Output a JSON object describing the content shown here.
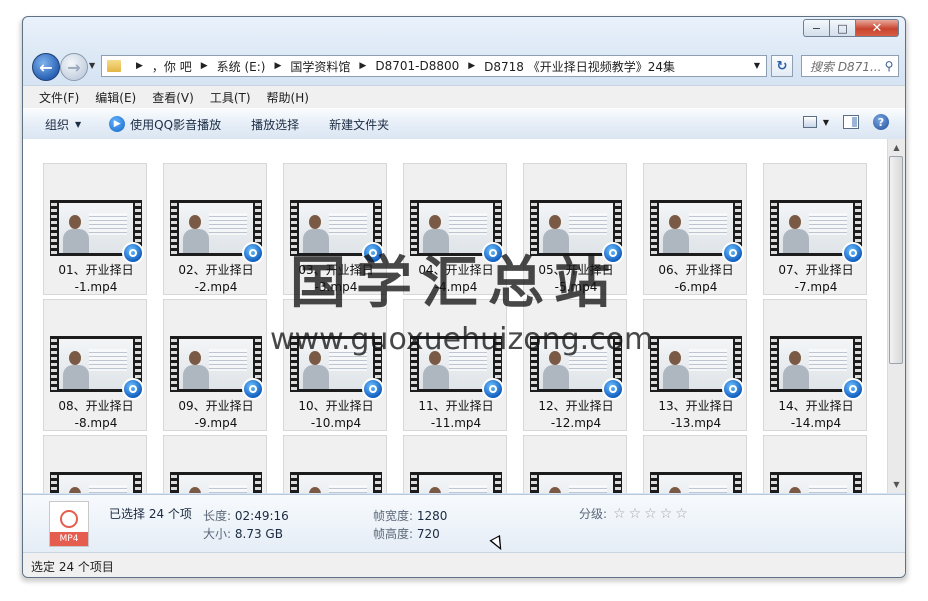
{
  "window": {
    "caption_buttons": {
      "minimize": "−",
      "maximize": "□",
      "close": "✕"
    }
  },
  "nav": {
    "back_icon": "arrow-left-icon",
    "forward_icon": "arrow-right-icon"
  },
  "address": {
    "breadcrumbs": [
      "，你  吧",
      "系统 (E:)",
      "国学资料馆",
      "D8701-D8800",
      "D8718 《开业择日视频教学》24集"
    ]
  },
  "search": {
    "placeholder": "搜索 D871..."
  },
  "menu": [
    "文件(F)",
    "编辑(E)",
    "查看(V)",
    "工具(T)",
    "帮助(H)"
  ],
  "toolbar": {
    "organize": "组织",
    "play_qq": "使用QQ影音播放",
    "play_selection": "播放选择",
    "new_folder": "新建文件夹"
  },
  "files": [
    {
      "name": "01、开业择日\n-1.mp4"
    },
    {
      "name": "02、开业择日\n-2.mp4"
    },
    {
      "name": "03、开业择日\n-3.mp4"
    },
    {
      "name": "04、开业择日\n-4.mp4"
    },
    {
      "name": "05、开业择日\n-5.mp4"
    },
    {
      "name": "06、开业择日\n-6.mp4"
    },
    {
      "name": "07、开业择日\n-7.mp4"
    },
    {
      "name": "08、开业择日\n-8.mp4"
    },
    {
      "name": "09、开业择日\n-9.mp4"
    },
    {
      "name": "10、开业择日\n-10.mp4"
    },
    {
      "name": "11、开业择日\n-11.mp4"
    },
    {
      "name": "12、开业择日\n-12.mp4"
    },
    {
      "name": "13、开业择日\n-13.mp4"
    },
    {
      "name": "14、开业择日\n-14.mp4"
    },
    {
      "name": ""
    },
    {
      "name": ""
    },
    {
      "name": ""
    },
    {
      "name": ""
    },
    {
      "name": ""
    },
    {
      "name": ""
    },
    {
      "name": ""
    }
  ],
  "details": {
    "icon_label": "MP4",
    "selected": "已选择 24 个项",
    "length_label": "长度:",
    "length_value": "02:49:16",
    "size_label": "大小:",
    "size_value": "8.73 GB",
    "width_label": "帧宽度:",
    "width_value": "1280",
    "height_label": "帧高度:",
    "height_value": "720",
    "rating_label": "分级:",
    "rating_stars": 0
  },
  "status": {
    "text": "选定 24 个项目"
  },
  "watermark": {
    "title": "国学汇总站",
    "url": "www.guoxuehuizong.com"
  }
}
